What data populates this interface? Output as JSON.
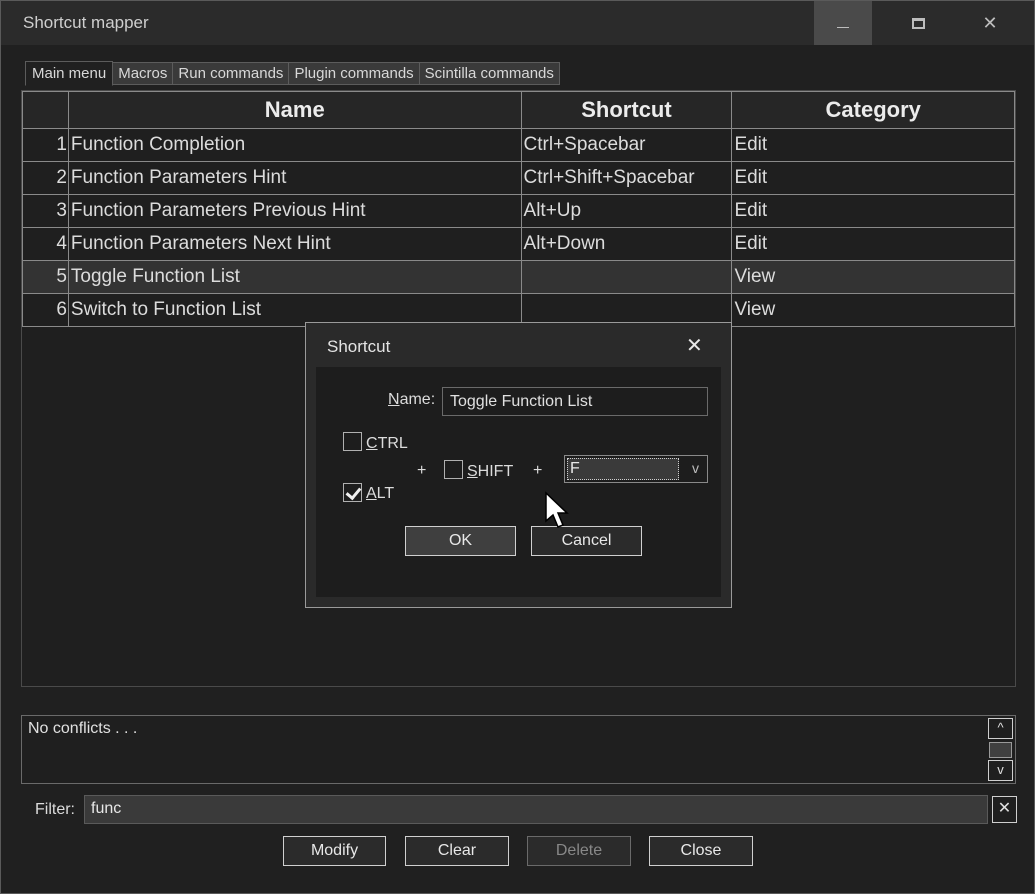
{
  "window": {
    "title": "Shortcut mapper",
    "minimize_icon": "minimize-icon",
    "maximize_icon": "maximize-icon",
    "close_glyph": "✕"
  },
  "tabs": [
    {
      "label": "Main menu",
      "active": true
    },
    {
      "label": "Macros"
    },
    {
      "label": "Run commands"
    },
    {
      "label": "Plugin commands"
    },
    {
      "label": "Scintilla commands"
    }
  ],
  "grid": {
    "columns": [
      "",
      "Name",
      "Shortcut",
      "Category"
    ],
    "rows": [
      {
        "num": "1",
        "name": "Function Completion",
        "shortcut": "Ctrl+Spacebar",
        "category": "Edit"
      },
      {
        "num": "2",
        "name": "Function Parameters Hint",
        "shortcut": "Ctrl+Shift+Spacebar",
        "category": "Edit"
      },
      {
        "num": "3",
        "name": "Function Parameters Previous Hint",
        "shortcut": "Alt+Up",
        "category": "Edit"
      },
      {
        "num": "4",
        "name": "Function Parameters Next Hint",
        "shortcut": "Alt+Down",
        "category": "Edit"
      },
      {
        "num": "5",
        "name": "Toggle Function List",
        "shortcut": "",
        "category": "View",
        "selected": true
      },
      {
        "num": "6",
        "name": "Switch to Function List",
        "shortcut": "",
        "category": "View"
      }
    ]
  },
  "dialog": {
    "title": "Shortcut",
    "close_glyph": "✕",
    "name_label_first": "N",
    "name_label_rest": "ame:",
    "name_value": "Toggle Function List",
    "ctrl_first": "C",
    "ctrl_rest": "TRL",
    "ctrl_checked": false,
    "alt_first": "A",
    "alt_rest": "LT",
    "alt_checked": true,
    "shift_first": "S",
    "shift_rest": "HIFT",
    "shift_checked": false,
    "plus": "+",
    "key_value": "F",
    "key_arrow": "v",
    "ok_label": "OK",
    "cancel_label": "Cancel"
  },
  "output": {
    "text": "No conflicts . . .",
    "scroll_up": "^",
    "scroll_down": "v"
  },
  "filter": {
    "label": "Filter:",
    "value": "func",
    "clear_glyph": "✕"
  },
  "buttons": {
    "modify": "Modify",
    "clear": "Clear",
    "delete": "Delete",
    "close": "Close"
  }
}
